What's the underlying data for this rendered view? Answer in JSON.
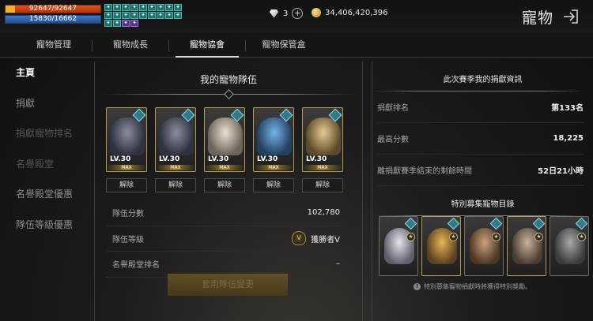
{
  "player": {
    "hp": "92647/92647",
    "mp": "15830/16662"
  },
  "buffs": [
    "✦",
    "✦",
    "✦",
    "✦",
    "✦",
    "✦",
    "✦",
    "✦",
    "✦",
    "✦",
    "✦",
    "✦",
    "✦",
    "✦",
    "✦",
    "✦",
    "✦",
    "✦",
    "✦",
    "✦",
    "✦",
    "✦"
  ],
  "currency": {
    "gems": "3",
    "gold": "34,406,420,396"
  },
  "header": {
    "title": "寵物"
  },
  "tabs": [
    {
      "label": "寵物管理"
    },
    {
      "label": "寵物成長"
    },
    {
      "label": "寵物協會"
    },
    {
      "label": "寵物保管盒"
    }
  ],
  "nav": [
    {
      "label": "主頁"
    },
    {
      "label": "捐獻"
    },
    {
      "label": "捐獻寵物排名"
    },
    {
      "label": "名譽殿堂"
    },
    {
      "label": "名譽殿堂優惠"
    },
    {
      "label": "隊伍等級優惠"
    }
  ],
  "team": {
    "title": "我的寵物隊伍",
    "pets": [
      {
        "level": "LV.30",
        "max": "MAX",
        "art": "wolf"
      },
      {
        "level": "LV.30",
        "max": "MAX",
        "art": "wolf"
      },
      {
        "level": "LV.30",
        "max": "MAX",
        "art": "lion"
      },
      {
        "level": "LV.30",
        "max": "MAX",
        "art": "blue"
      },
      {
        "level": "LV.30",
        "max": "MAX",
        "art": "camel"
      }
    ],
    "release_label": "解除",
    "score_label": "隊伍分數",
    "score_value": "102,780",
    "level_label": "隊伍等級",
    "level_emblem": "V",
    "level_value": "獲勝者V",
    "hall_label": "名譽殿堂排名",
    "hall_value": "–",
    "apply_label": "套用隊伍變更"
  },
  "season": {
    "title": "此次賽季我的捐獻資訊",
    "rows": [
      {
        "label": "捐獻排名",
        "value": "第133名"
      },
      {
        "label": "最高分數",
        "value": "18,225"
      },
      {
        "label": "離捐獻賽季結束的剩餘時間",
        "value": "52日21小時"
      }
    ]
  },
  "special": {
    "title": "特別募集寵物目錄",
    "birds": [
      "white",
      "yellow",
      "brown",
      "spot",
      "grey"
    ],
    "star_glyph": "★",
    "note": "特別募集寵物捐獻時將獲得特別獎勵。",
    "note_icon": "!"
  }
}
